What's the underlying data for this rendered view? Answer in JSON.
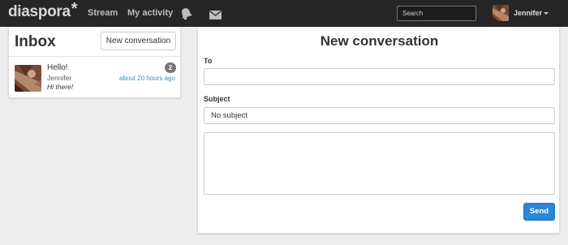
{
  "navbar": {
    "brand": "diaspora",
    "brand_star": "*",
    "links": {
      "stream": "Stream",
      "my_activity": "My activity"
    },
    "icons": {
      "notifications": "bell-icon",
      "messages": "envelope-icon"
    },
    "search": {
      "placeholder": "Search"
    },
    "user": {
      "name": "Jennifer",
      "avatar": "user-avatar-photo"
    }
  },
  "inbox": {
    "title": "Inbox",
    "new_conversation_label": "New conversation",
    "conversations": [
      {
        "subject": "Hello!",
        "author": "Jennifer",
        "snippet": "Hi there!",
        "unread_count": "2",
        "time": "about 20 hours ago"
      }
    ]
  },
  "compose": {
    "title": "New conversation",
    "to_label": "To",
    "to_value": "",
    "subject_label": "Subject",
    "subject_value": "No subject",
    "message_value": "",
    "send_label": "Send"
  },
  "colors": {
    "navbar_bg": "#262626",
    "accent": "#2a86d6",
    "link": "#3f8fba",
    "badge": "#777777"
  }
}
